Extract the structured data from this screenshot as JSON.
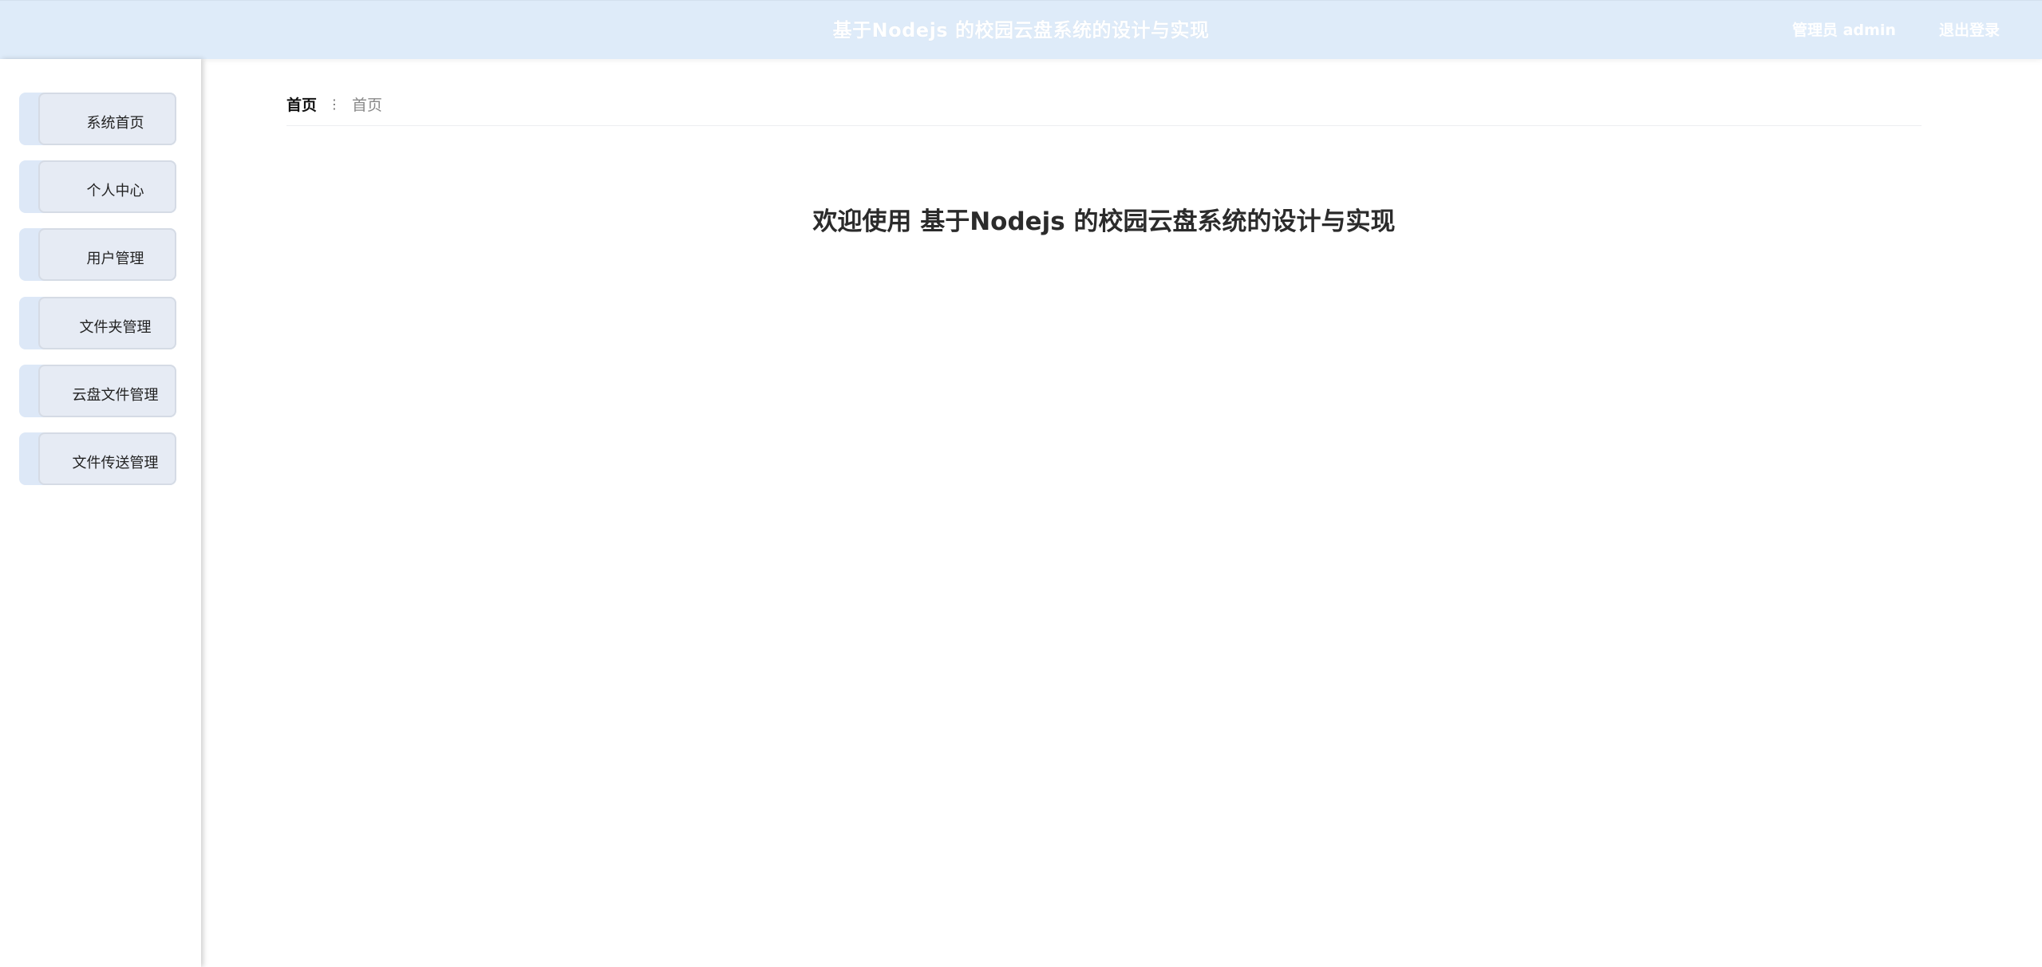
{
  "header": {
    "title": "基于Nodejs 的校园云盘系统的设计与实现",
    "admin_label": "管理员 admin",
    "logout_label": "退出登录"
  },
  "sidebar": {
    "items": [
      {
        "label": "系统首页"
      },
      {
        "label": "个人中心"
      },
      {
        "label": "用户管理"
      },
      {
        "label": "文件夹管理"
      },
      {
        "label": "云盘文件管理"
      },
      {
        "label": "文件传送管理"
      }
    ]
  },
  "breadcrumb": {
    "home": "首页",
    "separator": "⋮",
    "current": "首页"
  },
  "main": {
    "welcome": "欢迎使用 基于Nodejs 的校园云盘系统的设计与实现"
  },
  "colors": {
    "header_bg": "#deebf9",
    "menu_bg": "#e6ebf4",
    "menu_accent": "#dde8f7"
  }
}
